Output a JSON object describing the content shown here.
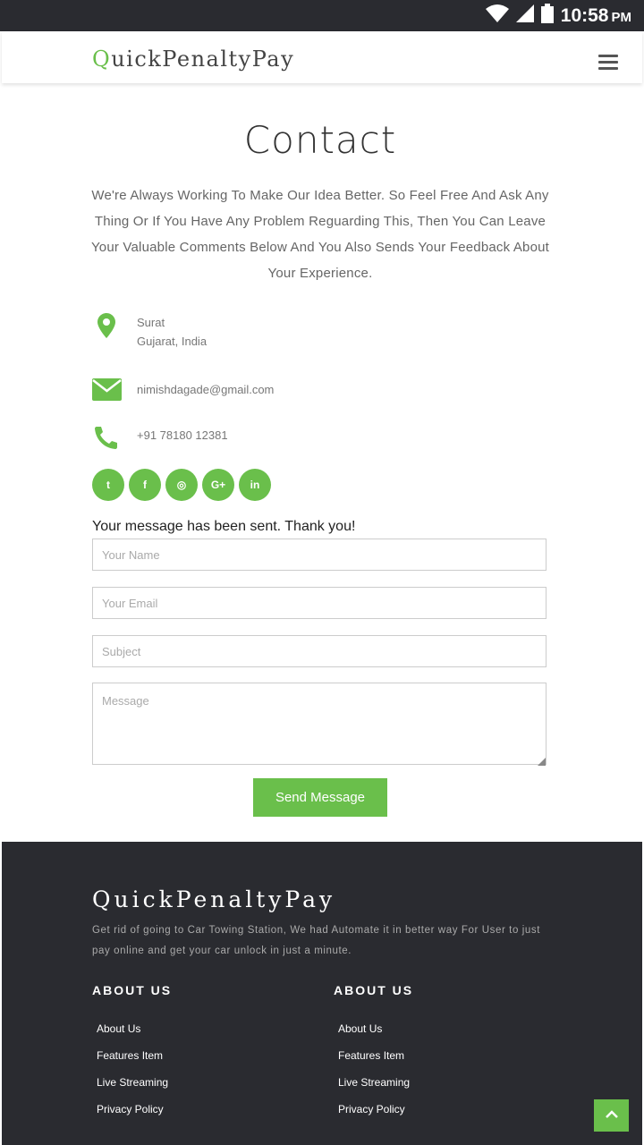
{
  "status_bar": {
    "time": "10:58",
    "ampm": "PM",
    "icons": [
      "wifi-icon",
      "signal-icon",
      "battery-icon"
    ]
  },
  "header": {
    "logo_first": "Q",
    "logo_rest": "uickPenaltyPay",
    "menu_icon": "hamburger-icon"
  },
  "main": {
    "title": "Contact",
    "intro": "We're Always Working To Make Our Idea Better. So Feel Free And Ask Any Thing Or If You Have Any Problem Reguarding This, Then You Can Leave Your Valuable Comments Below And You Also Sends Your Feedback About Your Experience.",
    "address_line1": "Surat",
    "address_line2": "Gujarat, India",
    "email": "nimishdagade@gmail.com",
    "phone": "+91 78180 12381",
    "social": [
      {
        "name": "twitter",
        "glyph": "t"
      },
      {
        "name": "facebook",
        "glyph": "f"
      },
      {
        "name": "instagram",
        "glyph": "◎"
      },
      {
        "name": "google-plus",
        "glyph": "G+"
      },
      {
        "name": "linkedin",
        "glyph": "in"
      }
    ],
    "sent_message": "Your message has been sent. Thank you!",
    "form": {
      "name_placeholder": "Your Name",
      "email_placeholder": "Your Email",
      "subject_placeholder": "Subject",
      "message_placeholder": "Message",
      "submit_label": "Send Message"
    }
  },
  "footer": {
    "logo": "QuickPenaltyPay",
    "description": "Get rid of going to Car Towing Station, We had Automate it in better way For User to just pay online and get your car unlock in just a minute.",
    "columns": [
      {
        "heading": "ABOUT US",
        "links": [
          "About Us",
          "Features Item",
          "Live Streaming",
          "Privacy Policy"
        ]
      },
      {
        "heading": "ABOUT US",
        "links": [
          "About Us",
          "Features Item",
          "Live Streaming",
          "Privacy Policy"
        ]
      }
    ],
    "back_to_top_icon": "chevron-up-icon"
  },
  "colors": {
    "accent": "#6abf4b",
    "dark": "#2a2b30",
    "text": "#666666"
  }
}
